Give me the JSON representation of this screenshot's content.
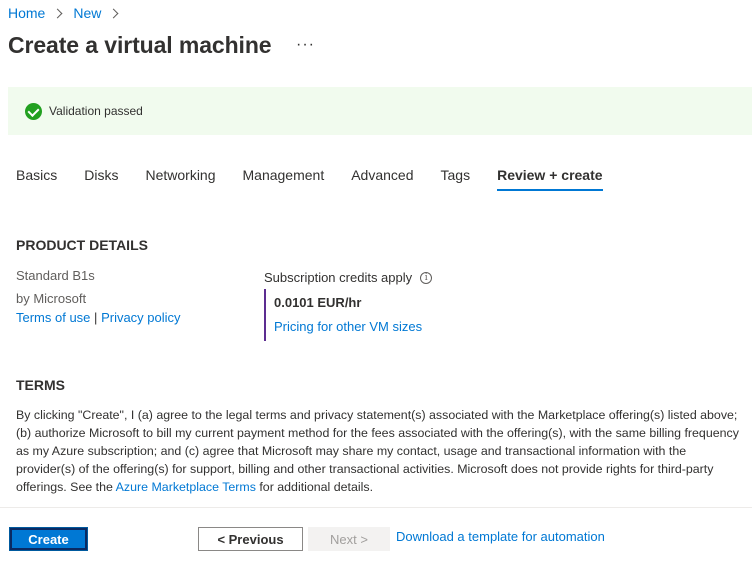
{
  "breadcrumb": {
    "items": [
      "Home",
      "New"
    ]
  },
  "page": {
    "title": "Create a virtual machine",
    "more_label": "···"
  },
  "validation": {
    "status_text": "Validation passed",
    "status_color": "#22a020"
  },
  "tabs": [
    {
      "label": "Basics",
      "active": false
    },
    {
      "label": "Disks",
      "active": false
    },
    {
      "label": "Networking",
      "active": false
    },
    {
      "label": "Management",
      "active": false
    },
    {
      "label": "Advanced",
      "active": false
    },
    {
      "label": "Tags",
      "active": false
    },
    {
      "label": "Review + create",
      "active": true
    }
  ],
  "product": {
    "heading": "PRODUCT DETAILS",
    "name": "Standard B1s",
    "vendor": "by Microsoft",
    "terms_link": "Terms of use",
    "separator": "|",
    "privacy_link": "Privacy policy",
    "credits_label": "Subscription credits apply",
    "price": "0.0101 EUR/hr",
    "pricing_link": "Pricing for other VM sizes"
  },
  "terms": {
    "heading": "TERMS",
    "text_before": "By clicking \"Create\", I (a) agree to the legal terms and privacy statement(s) associated with the Marketplace offering(s) listed above; (b) authorize Microsoft to bill my current payment method for the fees associated with the offering(s), with the same billing frequency as my Azure subscription; and (c) agree that Microsoft may share my contact, usage and transactional information with the provider(s) of the offering(s) for support, billing and other transactional activities. Microsoft does not provide rights for third-party offerings. See the ",
    "link": "Azure Marketplace Terms",
    "text_after": " for additional details."
  },
  "footer": {
    "create_label": "Create",
    "previous_label": "< Previous",
    "next_label": "Next >",
    "download_link": "Download a template for automation"
  },
  "colors": {
    "accent": "#0078d4",
    "banner_bg": "#f1fbee",
    "price_border": "#5c2d91"
  }
}
